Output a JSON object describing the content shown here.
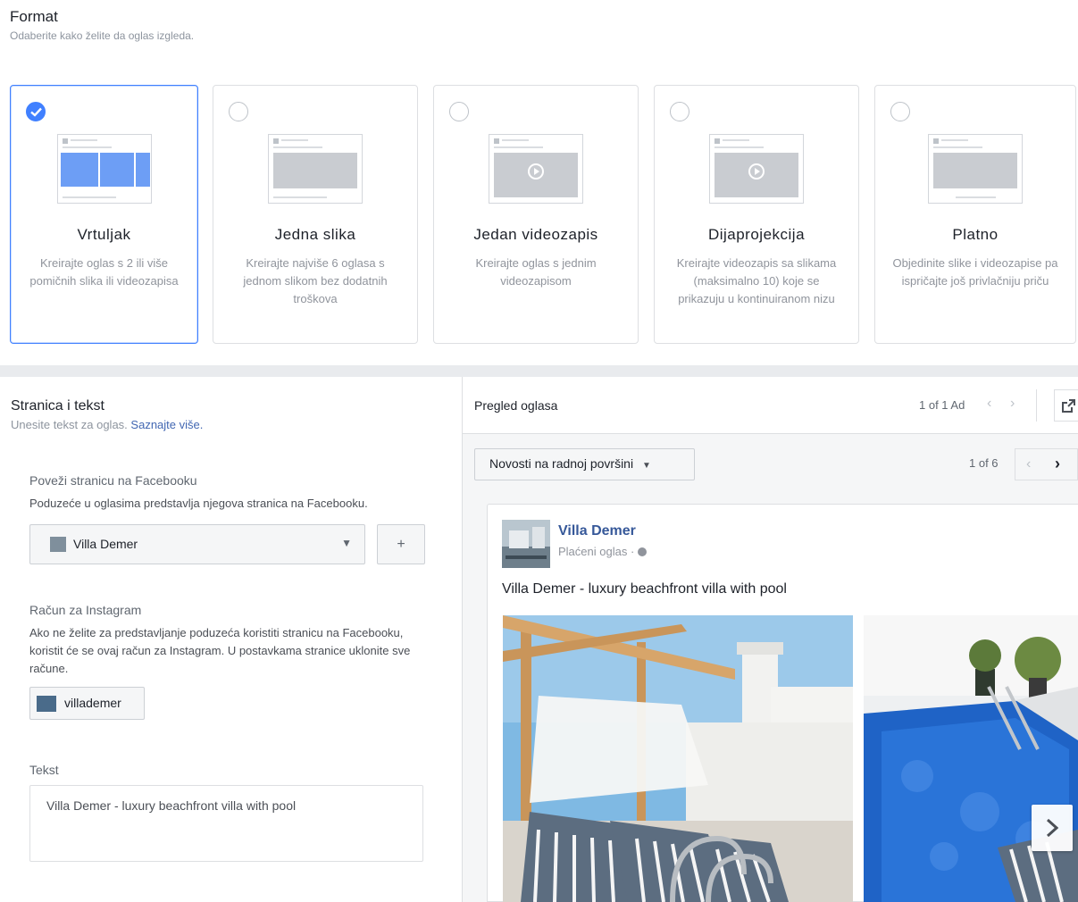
{
  "format": {
    "title": "Format",
    "subtitle": "Odaberite kako želite da oglas izgleda.",
    "options": [
      {
        "title": "Vrtuljak",
        "desc": "Kreirajte oglas s 2 ili više pomičnih slika ili videozapisa",
        "selected": true
      },
      {
        "title": "Jedna slika",
        "desc": "Kreirajte najviše 6 oglasa s jednom slikom bez dodatnih troškova",
        "selected": false
      },
      {
        "title": "Jedan videozapis",
        "desc": "Kreirajte oglas s jednim videozapisom",
        "selected": false
      },
      {
        "title": "Dijaprojekcija",
        "desc": "Kreirajte videozapis sa slikama (maksimalno 10) koje se prikazuju u kontinuiranom nizu",
        "selected": false
      },
      {
        "title": "Platno",
        "desc": "Objedinite slike i videozapise pa ispričajte još privlačniju priču",
        "selected": false
      }
    ]
  },
  "page_text": {
    "title": "Stranica i tekst",
    "subtitle": "Unesite tekst za oglas.",
    "learn_more": "Saznajte više.",
    "facebook_label": "Poveži stranicu na Facebooku",
    "facebook_help": "Poduzeće u oglasima predstavlja njegova stranica na Facebooku.",
    "page_selected": "Villa Demer",
    "add_symbol": "+",
    "instagram_label": "Račun za Instagram",
    "instagram_help": "Ako ne želite za predstavljanje poduzeća koristiti stranicu na Facebooku, koristit će se ovaj račun za Instagram. U postavkama stranice uklonite sve račune.",
    "instagram_account": "villademer",
    "text_label": "Tekst",
    "text_value": "Villa Demer - luxury beachfront villa with pool"
  },
  "preview": {
    "title": "Pregled oglasa",
    "ad_count": "1 of 1 Ad",
    "placement": "Novosti na radnoj površini",
    "placement_count": "1 of 6",
    "ad": {
      "page_name": "Villa Demer",
      "sponsored": "Plaćeni oglas ·",
      "text": "Villa Demer - luxury beachfront villa with pool"
    }
  },
  "colors": {
    "accent": "#4080ff",
    "link": "#365899",
    "divider": "#e9ebee"
  },
  "icons": [
    "check-icon",
    "chevron-left-icon",
    "chevron-right-icon",
    "external-link-icon",
    "caret-down-icon",
    "globe-icon",
    "play-icon"
  ]
}
